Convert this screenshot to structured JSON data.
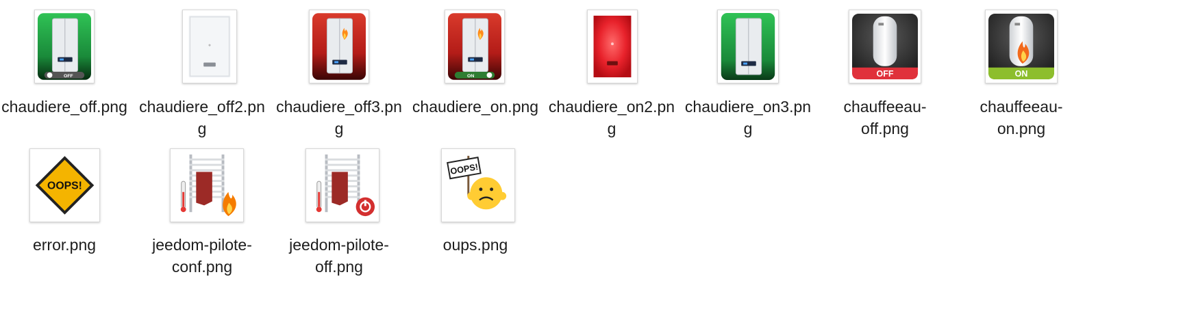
{
  "files": [
    {
      "name": "chaudiere_off.png",
      "line1": "chaudiere_off.png",
      "line2": "",
      "icon": "boiler-green-off-icon"
    },
    {
      "name": "chaudiere_off2.png",
      "line1": "chaudiere_off2.pn",
      "line2": "g",
      "icon": "boiler-white-icon"
    },
    {
      "name": "chaudiere_off3.png",
      "line1": "chaudiere_off3.pn",
      "line2": "g",
      "icon": "boiler-red-flame-icon"
    },
    {
      "name": "chaudiere_on.png",
      "line1": "chaudiere_on.png",
      "line2": "",
      "icon": "boiler-red-on-icon"
    },
    {
      "name": "chaudiere_on2.png",
      "line1": "chaudiere_on2.pn",
      "line2": "g",
      "icon": "boiler-red-glow-icon"
    },
    {
      "name": "chaudiere_on3.png",
      "line1": "chaudiere_on3.pn",
      "line2": "g",
      "icon": "boiler-green-icon"
    },
    {
      "name": "chauffeeau-off.png",
      "line1": "chauffeeau-",
      "line2": "off.png",
      "icon": "water-heater-off-icon"
    },
    {
      "name": "chauffeeau-on.png",
      "line1": "chauffeeau-",
      "line2": "on.png",
      "icon": "water-heater-on-icon"
    },
    {
      "name": "error.png",
      "line1": "error.png",
      "line2": "",
      "icon": "oops-warning-sign-icon"
    },
    {
      "name": "jeedom-pilote-conf.png",
      "line1": "jeedom-pilote-",
      "line2": "conf.png",
      "icon": "towel-radiator-flame-icon"
    },
    {
      "name": "jeedom-pilote-off.png",
      "line1": "jeedom-pilote-",
      "line2": "off.png",
      "icon": "towel-radiator-power-icon"
    },
    {
      "name": "oups.png",
      "line1": "oups.png",
      "line2": "",
      "icon": "oops-sad-face-icon"
    }
  ],
  "badges": {
    "off": "OFF",
    "on": "ON",
    "oops": "OOPS!"
  },
  "colors": {
    "boiler_green": "#1fa446",
    "boiler_red": "#c62320",
    "heater_dark": "#2f2f2f",
    "badge_red": "#e0313b",
    "badge_green": "#8dbe2d",
    "warning_yellow": "#f4b400"
  }
}
